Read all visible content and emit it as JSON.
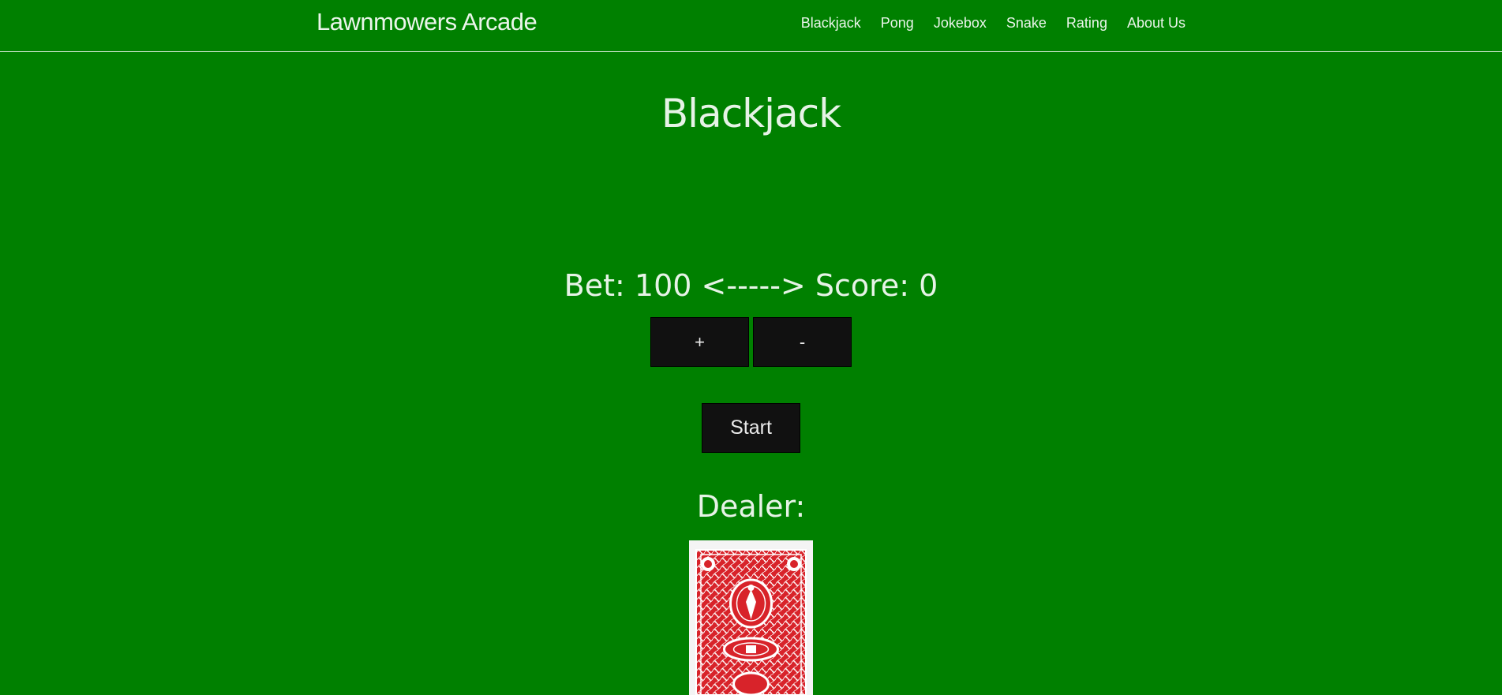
{
  "nav": {
    "brand": "Lawnmowers Arcade",
    "links": [
      "Blackjack",
      "Pong",
      "Jokebox",
      "Snake",
      "Rating",
      "About Us"
    ]
  },
  "main": {
    "title": "Blackjack",
    "bet_line": "Bet: 100 <-----> Score: 0",
    "plus_label": "+",
    "minus_label": "-",
    "start_label": "Start",
    "dealer_label": "Dealer:"
  },
  "colors": {
    "background": "#008000",
    "button": "#111111",
    "card_back": "#d8232a"
  },
  "icons": {
    "dealer_card": "card-back-icon"
  }
}
